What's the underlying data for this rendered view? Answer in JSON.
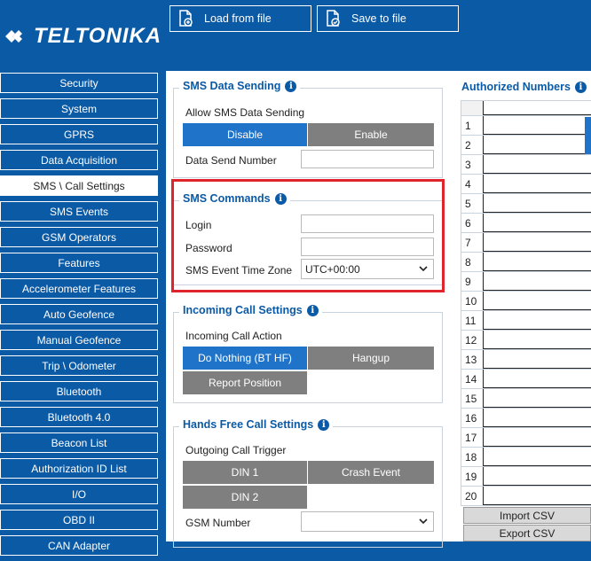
{
  "brand": {
    "name": "TELTONIKA"
  },
  "toolbar": {
    "load_label": "Load from file",
    "save_label": "Save to file"
  },
  "sidebar": {
    "items": [
      {
        "label": "Security"
      },
      {
        "label": "System"
      },
      {
        "label": "GPRS"
      },
      {
        "label": "Data Acquisition"
      },
      {
        "label": "SMS \\ Call Settings",
        "active": true
      },
      {
        "label": "SMS Events"
      },
      {
        "label": "GSM Operators"
      },
      {
        "label": "Features"
      },
      {
        "label": "Accelerometer Features"
      },
      {
        "label": "Auto Geofence"
      },
      {
        "label": "Manual Geofence"
      },
      {
        "label": "Trip \\ Odometer"
      },
      {
        "label": "Bluetooth"
      },
      {
        "label": "Bluetooth 4.0"
      },
      {
        "label": "Beacon List"
      },
      {
        "label": "Authorization ID List"
      },
      {
        "label": "I/O"
      },
      {
        "label": "OBD II"
      },
      {
        "label": "CAN Adapter"
      }
    ]
  },
  "sms_data_sending": {
    "title": "SMS Data Sending",
    "allow_label": "Allow SMS Data Sending",
    "disable_label": "Disable",
    "enable_label": "Enable",
    "selected": "Disable",
    "send_number_label": "Data Send Number",
    "send_number_value": ""
  },
  "sms_commands": {
    "title": "SMS Commands",
    "login_label": "Login",
    "login_value": "",
    "password_label": "Password",
    "password_value": "",
    "timezone_label": "SMS Event Time Zone",
    "timezone_value": "UTC+00:00"
  },
  "incoming_call": {
    "title": "Incoming Call Settings",
    "action_label": "Incoming Call Action",
    "options": [
      "Do Nothing (BT HF)",
      "Hangup",
      "Report Position"
    ],
    "selected": "Do Nothing (BT HF)"
  },
  "hands_free": {
    "title": "Hands Free Call Settings",
    "trigger_label": "Outgoing Call Trigger",
    "options": [
      "DIN 1",
      "Crash Event",
      "DIN 2"
    ],
    "gsm_number_label": "GSM Number",
    "gsm_number_value": ""
  },
  "authorized_numbers": {
    "title": "Authorized Numbers",
    "rows": [
      "1",
      "2",
      "3",
      "4",
      "5",
      "6",
      "7",
      "8",
      "9",
      "10",
      "11",
      "12",
      "13",
      "14",
      "15",
      "16",
      "17",
      "18",
      "19",
      "20"
    ],
    "import_label": "Import CSV",
    "export_label": "Export CSV"
  },
  "colors": {
    "brand_blue": "#0b5aa6",
    "selected_blue": "#1f74c9",
    "inactive_gray": "#7f7f7f",
    "highlight_red": "#e0242b"
  },
  "icons": [
    "load-file-icon",
    "save-file-icon",
    "info-icon",
    "chevron-down-icon",
    "teltonika-logo-icon"
  ]
}
